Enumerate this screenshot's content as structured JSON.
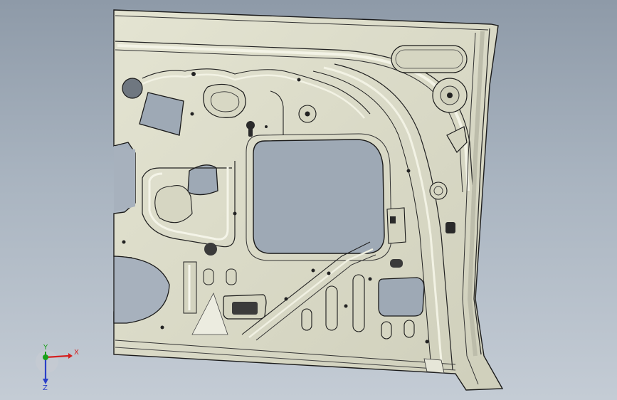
{
  "viewport": {
    "background_top": "#8e9aa8",
    "background_bottom": "#c4ccd5"
  },
  "part": {
    "fill": "#dcdcc8",
    "edge": "#1a1a1a",
    "shadow": "#a9a996"
  },
  "triad": {
    "x_label": "X",
    "y_label": "Y",
    "z_label": "Z",
    "x_color": "#d42020",
    "y_color": "#19a019",
    "z_color": "#2a3fc8"
  }
}
